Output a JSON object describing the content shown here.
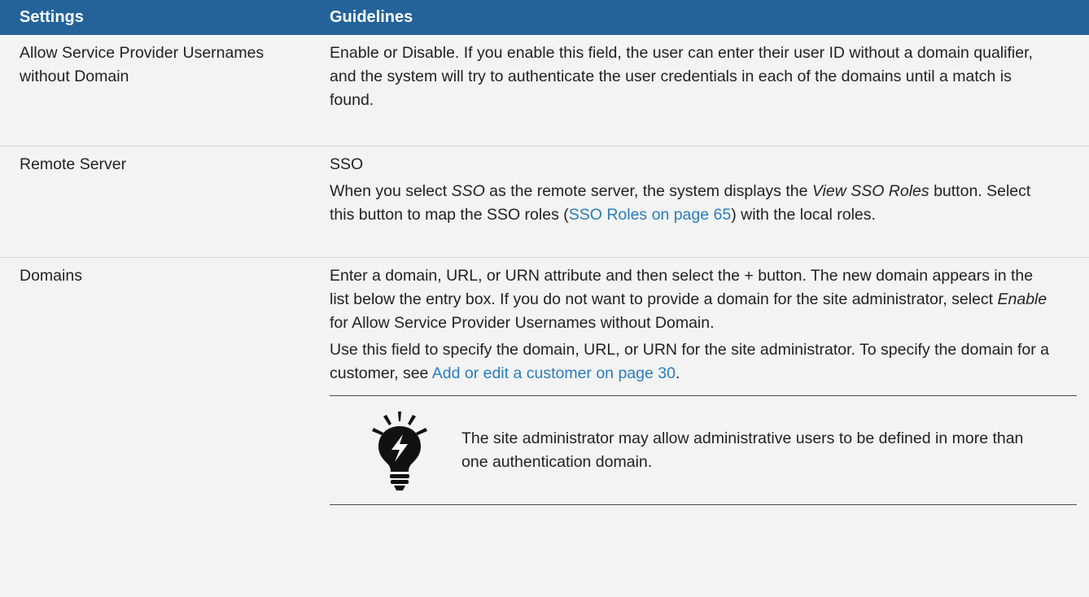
{
  "table": {
    "headers": {
      "settings": "Settings",
      "guidelines": "Guidelines"
    },
    "rows": [
      {
        "setting": "Allow Service Provider Usernames without Domain",
        "guideline": "Enable or Disable. If you enable this field, the user can enter their user ID without a domain qualifier, and the system will try to authenticate the user credentials in each of the domains until a match is found."
      },
      {
        "setting": "Remote Server",
        "guideline_value": "SSO",
        "guideline_parts": {
          "p1": "When you select ",
          "p2": "SSO",
          "p3": " as the remote server, the system displays the ",
          "p4": "View SSO Roles",
          "p5": " button. Select this button to map the SSO roles (",
          "link": "SSO Roles on page 65",
          "p6": ") with the local roles."
        }
      },
      {
        "setting": "Domains",
        "para1": {
          "p1": "Enter a domain, URL, or URN attribute and then select the + button. The new domain appears in the list below the entry box. If you do not want to provide a domain for the site administrator, select ",
          "em": "Enable",
          "p2": " for Allow Service Provider Usernames without Domain."
        },
        "para2": {
          "p1": "Use this field to specify the domain, URL, or URN for the site administrator. To specify the domain for a customer, see ",
          "link": "Add or edit a customer on page 30",
          "p2": "."
        },
        "tip": {
          "icon": "lightbulb-icon",
          "text": "The site administrator may allow administrative users to be defined in more than one authentication domain."
        }
      }
    ]
  },
  "colors": {
    "header_bg": "#23639a",
    "row_bg": "#f3f3f3",
    "link": "#2a7dbf"
  }
}
